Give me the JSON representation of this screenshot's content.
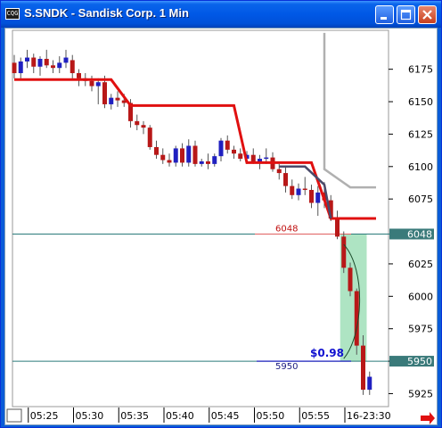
{
  "window": {
    "title": "S.SNDK - Sandisk Corp. 1 Min",
    "icon_text": "CQG",
    "buttons": [
      "minimize-icon",
      "maximize-icon",
      "close-icon"
    ],
    "scroll_arrow": "red-right-arrow-icon"
  },
  "colors": {
    "up_candle": "#2020c0",
    "down_candle": "#b81818",
    "price_box": "#3a7a7a",
    "red_line": "#e01010",
    "gray_line": "#b8b8b8",
    "green_band": "#a0dfb8"
  },
  "chart_data": {
    "type": "candlestick",
    "ylim": [
      5915,
      6205
    ],
    "y_ticks": [
      5925,
      5950,
      5975,
      6000,
      6025,
      6048,
      6075,
      6100,
      6125,
      6150,
      6175
    ],
    "x_ticks": [
      "05:25",
      "05:30",
      "05:35",
      "05:40",
      "05:45",
      "05:50",
      "05:55",
      "16-23:30"
    ],
    "price_boxes": [
      {
        "label": "6048",
        "value": 6048
      },
      {
        "label": "5950",
        "value": 5950
      }
    ],
    "reference_lines": [
      {
        "label": "6048",
        "value": 6048,
        "color": "#2a7a7a"
      },
      {
        "label": "5950",
        "value": 5950,
        "color": "#2a7a7a"
      }
    ],
    "annotation": {
      "label": "$0.98",
      "color": "#1010d0"
    },
    "candles": [
      [
        6180,
        6186,
        6168,
        6172
      ],
      [
        6172,
        6184,
        6168,
        6181
      ],
      [
        6181,
        6190,
        6176,
        6184
      ],
      [
        6184,
        6187,
        6172,
        6177
      ],
      [
        6177,
        6185,
        6170,
        6183
      ],
      [
        6183,
        6190,
        6176,
        6178
      ],
      [
        6178,
        6182,
        6172,
        6176
      ],
      [
        6176,
        6185,
        6172,
        6180
      ],
      [
        6180,
        6190,
        6176,
        6184
      ],
      [
        6182,
        6186,
        6168,
        6172
      ],
      [
        6172,
        6175,
        6162,
        6168
      ],
      [
        6168,
        6172,
        6162,
        6166
      ],
      [
        6166,
        6170,
        6158,
        6162
      ],
      [
        6162,
        6168,
        6148,
        6165
      ],
      [
        6165,
        6170,
        6145,
        6148
      ],
      [
        6148,
        6156,
        6144,
        6153
      ],
      [
        6153,
        6158,
        6146,
        6151
      ],
      [
        6151,
        6156,
        6146,
        6149
      ],
      [
        6149,
        6152,
        6130,
        6135
      ],
      [
        6135,
        6140,
        6128,
        6132
      ],
      [
        6132,
        6135,
        6125,
        6130
      ],
      [
        6130,
        6132,
        6113,
        6115
      ],
      [
        6115,
        6120,
        6106,
        6109
      ],
      [
        6109,
        6114,
        6102,
        6105
      ],
      [
        6105,
        6110,
        6100,
        6103
      ],
      [
        6103,
        6116,
        6100,
        6114
      ],
      [
        6114,
        6118,
        6100,
        6103
      ],
      [
        6103,
        6121,
        6100,
        6116
      ],
      [
        6116,
        6120,
        6100,
        6102
      ],
      [
        6102,
        6106,
        6100,
        6104
      ],
      [
        6104,
        6110,
        6098,
        6102
      ],
      [
        6102,
        6110,
        6100,
        6108
      ],
      [
        6108,
        6122,
        6104,
        6120
      ],
      [
        6120,
        6124,
        6110,
        6113
      ],
      [
        6113,
        6116,
        6106,
        6110
      ],
      [
        6110,
        6114,
        6104,
        6106
      ],
      [
        6106,
        6112,
        6102,
        6109
      ],
      [
        6109,
        6114,
        6102,
        6104
      ],
      [
        6104,
        6109,
        6098,
        6106
      ],
      [
        6106,
        6114,
        6102,
        6107
      ],
      [
        6107,
        6111,
        6096,
        6098
      ],
      [
        6098,
        6102,
        6090,
        6095
      ],
      [
        6095,
        6100,
        6080,
        6085
      ],
      [
        6085,
        6090,
        6075,
        6078
      ],
      [
        6078,
        6087,
        6074,
        6083
      ],
      [
        6083,
        6092,
        6078,
        6082
      ],
      [
        6082,
        6086,
        6068,
        6072
      ],
      [
        6072,
        6085,
        6062,
        6080
      ],
      [
        6080,
        6088,
        6068,
        6074
      ],
      [
        6074,
        6078,
        6058,
        6060
      ],
      [
        6060,
        6066,
        6044,
        6046
      ],
      [
        6046,
        6050,
        6018,
        6022
      ],
      [
        6022,
        6026,
        6000,
        6004
      ],
      [
        6004,
        6006,
        5955,
        5962
      ],
      [
        5962,
        5970,
        5924,
        5928
      ],
      [
        5928,
        5942,
        5924,
        5938
      ]
    ],
    "series": [
      {
        "color": "#e01010",
        "points": [
          [
            0,
            6167
          ],
          [
            15,
            6167
          ],
          [
            18,
            6147
          ],
          [
            34,
            6147
          ],
          [
            36,
            6103
          ],
          [
            46,
            6103
          ],
          [
            49,
            6060
          ],
          [
            56,
            6060
          ]
        ]
      },
      {
        "color": "#b0b0b0",
        "points": [
          [
            48,
            6203
          ],
          [
            48,
            6098
          ],
          [
            52,
            6084
          ],
          [
            56,
            6084
          ]
        ]
      },
      {
        "color": "#4a4a6a",
        "points": [
          [
            41,
            6100
          ],
          [
            45,
            6100
          ],
          [
            48,
            6086
          ],
          [
            49,
            6060
          ]
        ]
      }
    ],
    "green_band": {
      "from_index": 51,
      "to_index": 54,
      "top": 6048,
      "bottom": 5950
    },
    "x_labels_text": [
      "05:25",
      "05:30",
      "05:35",
      "05:40",
      "05:45",
      "05:50",
      "05:55",
      "16-23:30"
    ]
  }
}
